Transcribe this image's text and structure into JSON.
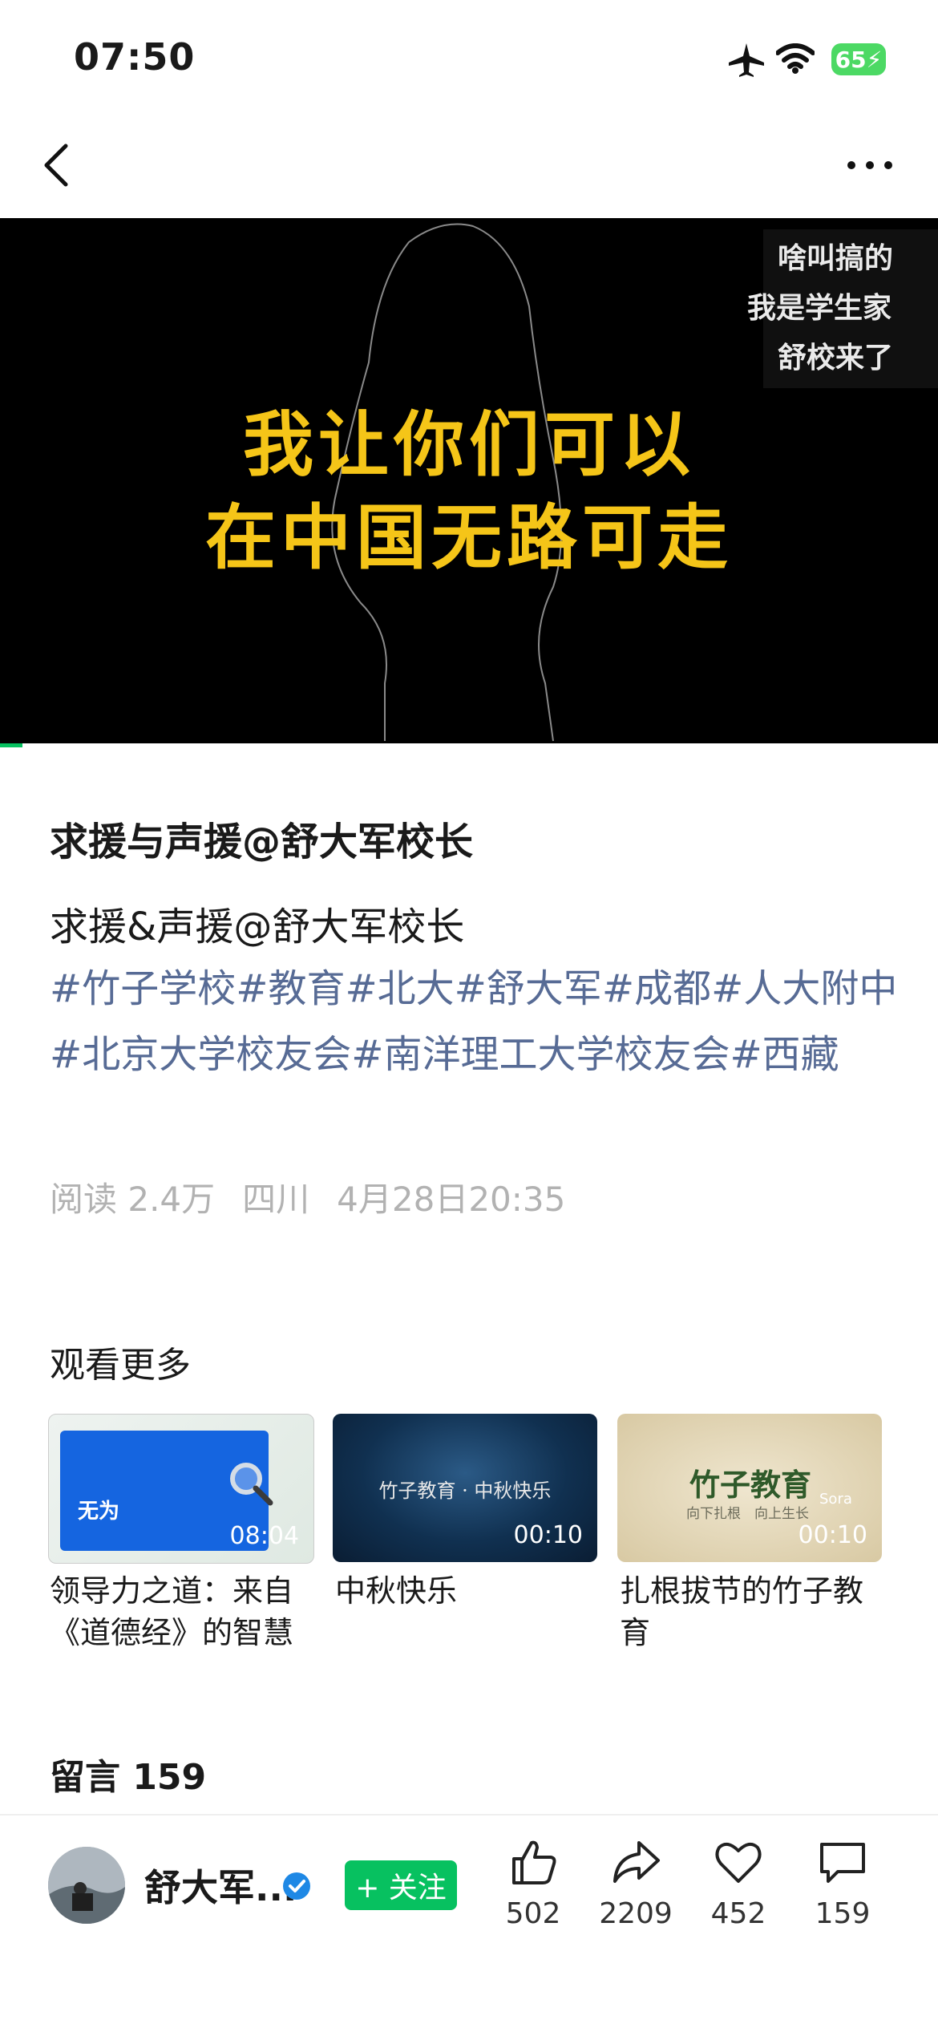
{
  "status_bar": {
    "time": "07:50",
    "battery": "65"
  },
  "video": {
    "caption_line1": "我让你们可以",
    "caption_line2": "在中国无路可走",
    "overlay_lines": [
      "啥叫搞的",
      "我是学生家",
      "舒校来了"
    ]
  },
  "article": {
    "title": "求援与声援@舒大军校长",
    "body": "求援&声援@舒大军校长",
    "hashtags": "#竹子学校#教育#北大#舒大军#成都#人大附中#北京大学校友会#南洋理工大学校友会#西藏",
    "meta": {
      "reads": "阅读 2.4万",
      "location": "四川",
      "date": "4月28日20:35"
    }
  },
  "more": {
    "title": "观看更多",
    "videos": [
      {
        "title": "领导力之道：来自《道德经》的智慧",
        "duration": "08:04",
        "thumb_text": "无为"
      },
      {
        "title": "中秋快乐",
        "duration": "00:10",
        "thumb_text": "竹子教育 · 中秋快乐"
      },
      {
        "title": "扎根拔节的竹子教育",
        "duration": "00:10",
        "thumb_text": "竹子教育",
        "thumb_sub": "向下扎根　向上生长",
        "thumb_badge": "Sora"
      }
    ]
  },
  "comments": {
    "title": "留言 159"
  },
  "bottom_bar": {
    "author": "舒大军...",
    "follow_label": "+ 关注",
    "likes": "502",
    "shares": "2209",
    "favorites": "452",
    "comments": "159"
  },
  "colors": {
    "accent": "#07c160",
    "link": "#576b95",
    "caption": "#f5c518"
  }
}
